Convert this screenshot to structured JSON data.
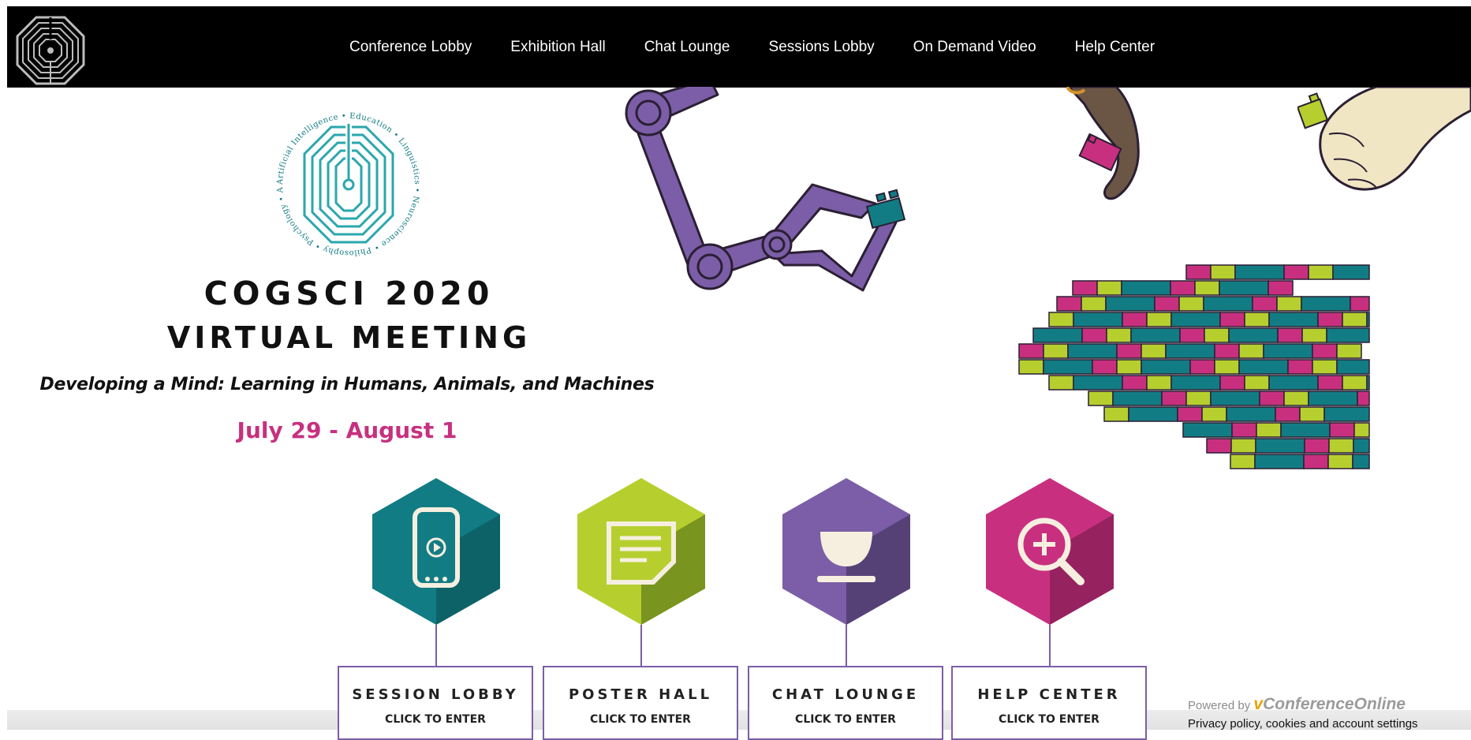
{
  "nav": {
    "items": [
      {
        "label": "Conference Lobby"
      },
      {
        "label": "Exhibition Hall"
      },
      {
        "label": "Chat Lounge"
      },
      {
        "label": "Sessions Lobby"
      },
      {
        "label": "On Demand Video"
      },
      {
        "label": "Help Center"
      }
    ]
  },
  "hero": {
    "title_line1": "COGSCI 2020",
    "title_line2": "VIRTUAL MEETING",
    "subtitle": "Developing a Mind: Learning in Humans, Animals, and Machines",
    "dates": "July 29 - August 1"
  },
  "cards": [
    {
      "title": "SESSION LOBBY",
      "cta": "CLICK TO ENTER",
      "icon": "phone-play-icon",
      "color": "#127c84"
    },
    {
      "title": "POSTER HALL",
      "cta": "CLICK TO ENTER",
      "icon": "note-icon",
      "color": "#b6cf2f"
    },
    {
      "title": "CHAT LOUNGE",
      "cta": "CLICK TO ENTER",
      "icon": "cup-icon",
      "color": "#7b5ea7"
    },
    {
      "title": "HELP CENTER",
      "cta": "CLICK TO ENTER",
      "icon": "magnifier-plus-icon",
      "color": "#c8307f"
    }
  ],
  "footer": {
    "powered_by": "Powered by",
    "brand_v": "v",
    "brand_name": "ConferenceOnline",
    "privacy": "Privacy policy, cookies and account settings"
  },
  "colors": {
    "teal": "#127c84",
    "lime": "#b6cf2f",
    "purple": "#7b5ea7",
    "magenta": "#c8307f",
    "topbar": "#000000"
  }
}
